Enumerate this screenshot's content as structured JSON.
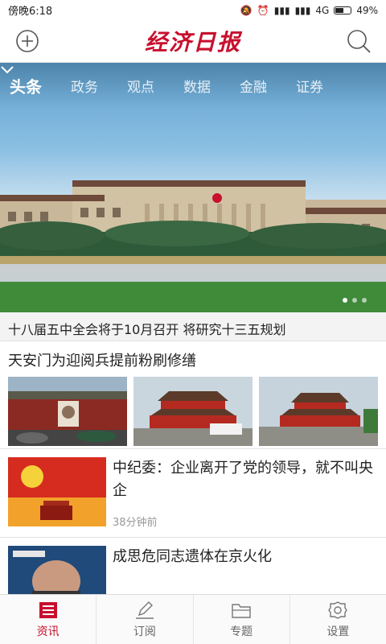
{
  "status": {
    "time": "傍晚6:18",
    "network": "4G",
    "battery": "49%"
  },
  "app": {
    "logo_text": "经济日报",
    "brand_color": "#c8102e"
  },
  "tabs": [
    {
      "label": "头条",
      "active": true
    },
    {
      "label": "政务"
    },
    {
      "label": "观点"
    },
    {
      "label": "数据"
    },
    {
      "label": "金融"
    },
    {
      "label": "证券"
    }
  ],
  "hero": {
    "caption": "十八届五中全会将于10月召开 将研究十三五规划"
  },
  "news_multi": {
    "title": "天安门为迎阅兵提前粉刷修缮"
  },
  "news": [
    {
      "title": "中纪委：企业离开了党的领导，就不叫央企",
      "time": "38分钟前"
    },
    {
      "title": "成思危同志遗体在京火化",
      "time": ""
    }
  ],
  "nav": [
    {
      "label": "资讯",
      "icon": "news-icon",
      "active": true
    },
    {
      "label": "订阅",
      "icon": "edit-icon"
    },
    {
      "label": "专题",
      "icon": "folder-icon"
    },
    {
      "label": "设置",
      "icon": "settings-icon"
    }
  ]
}
